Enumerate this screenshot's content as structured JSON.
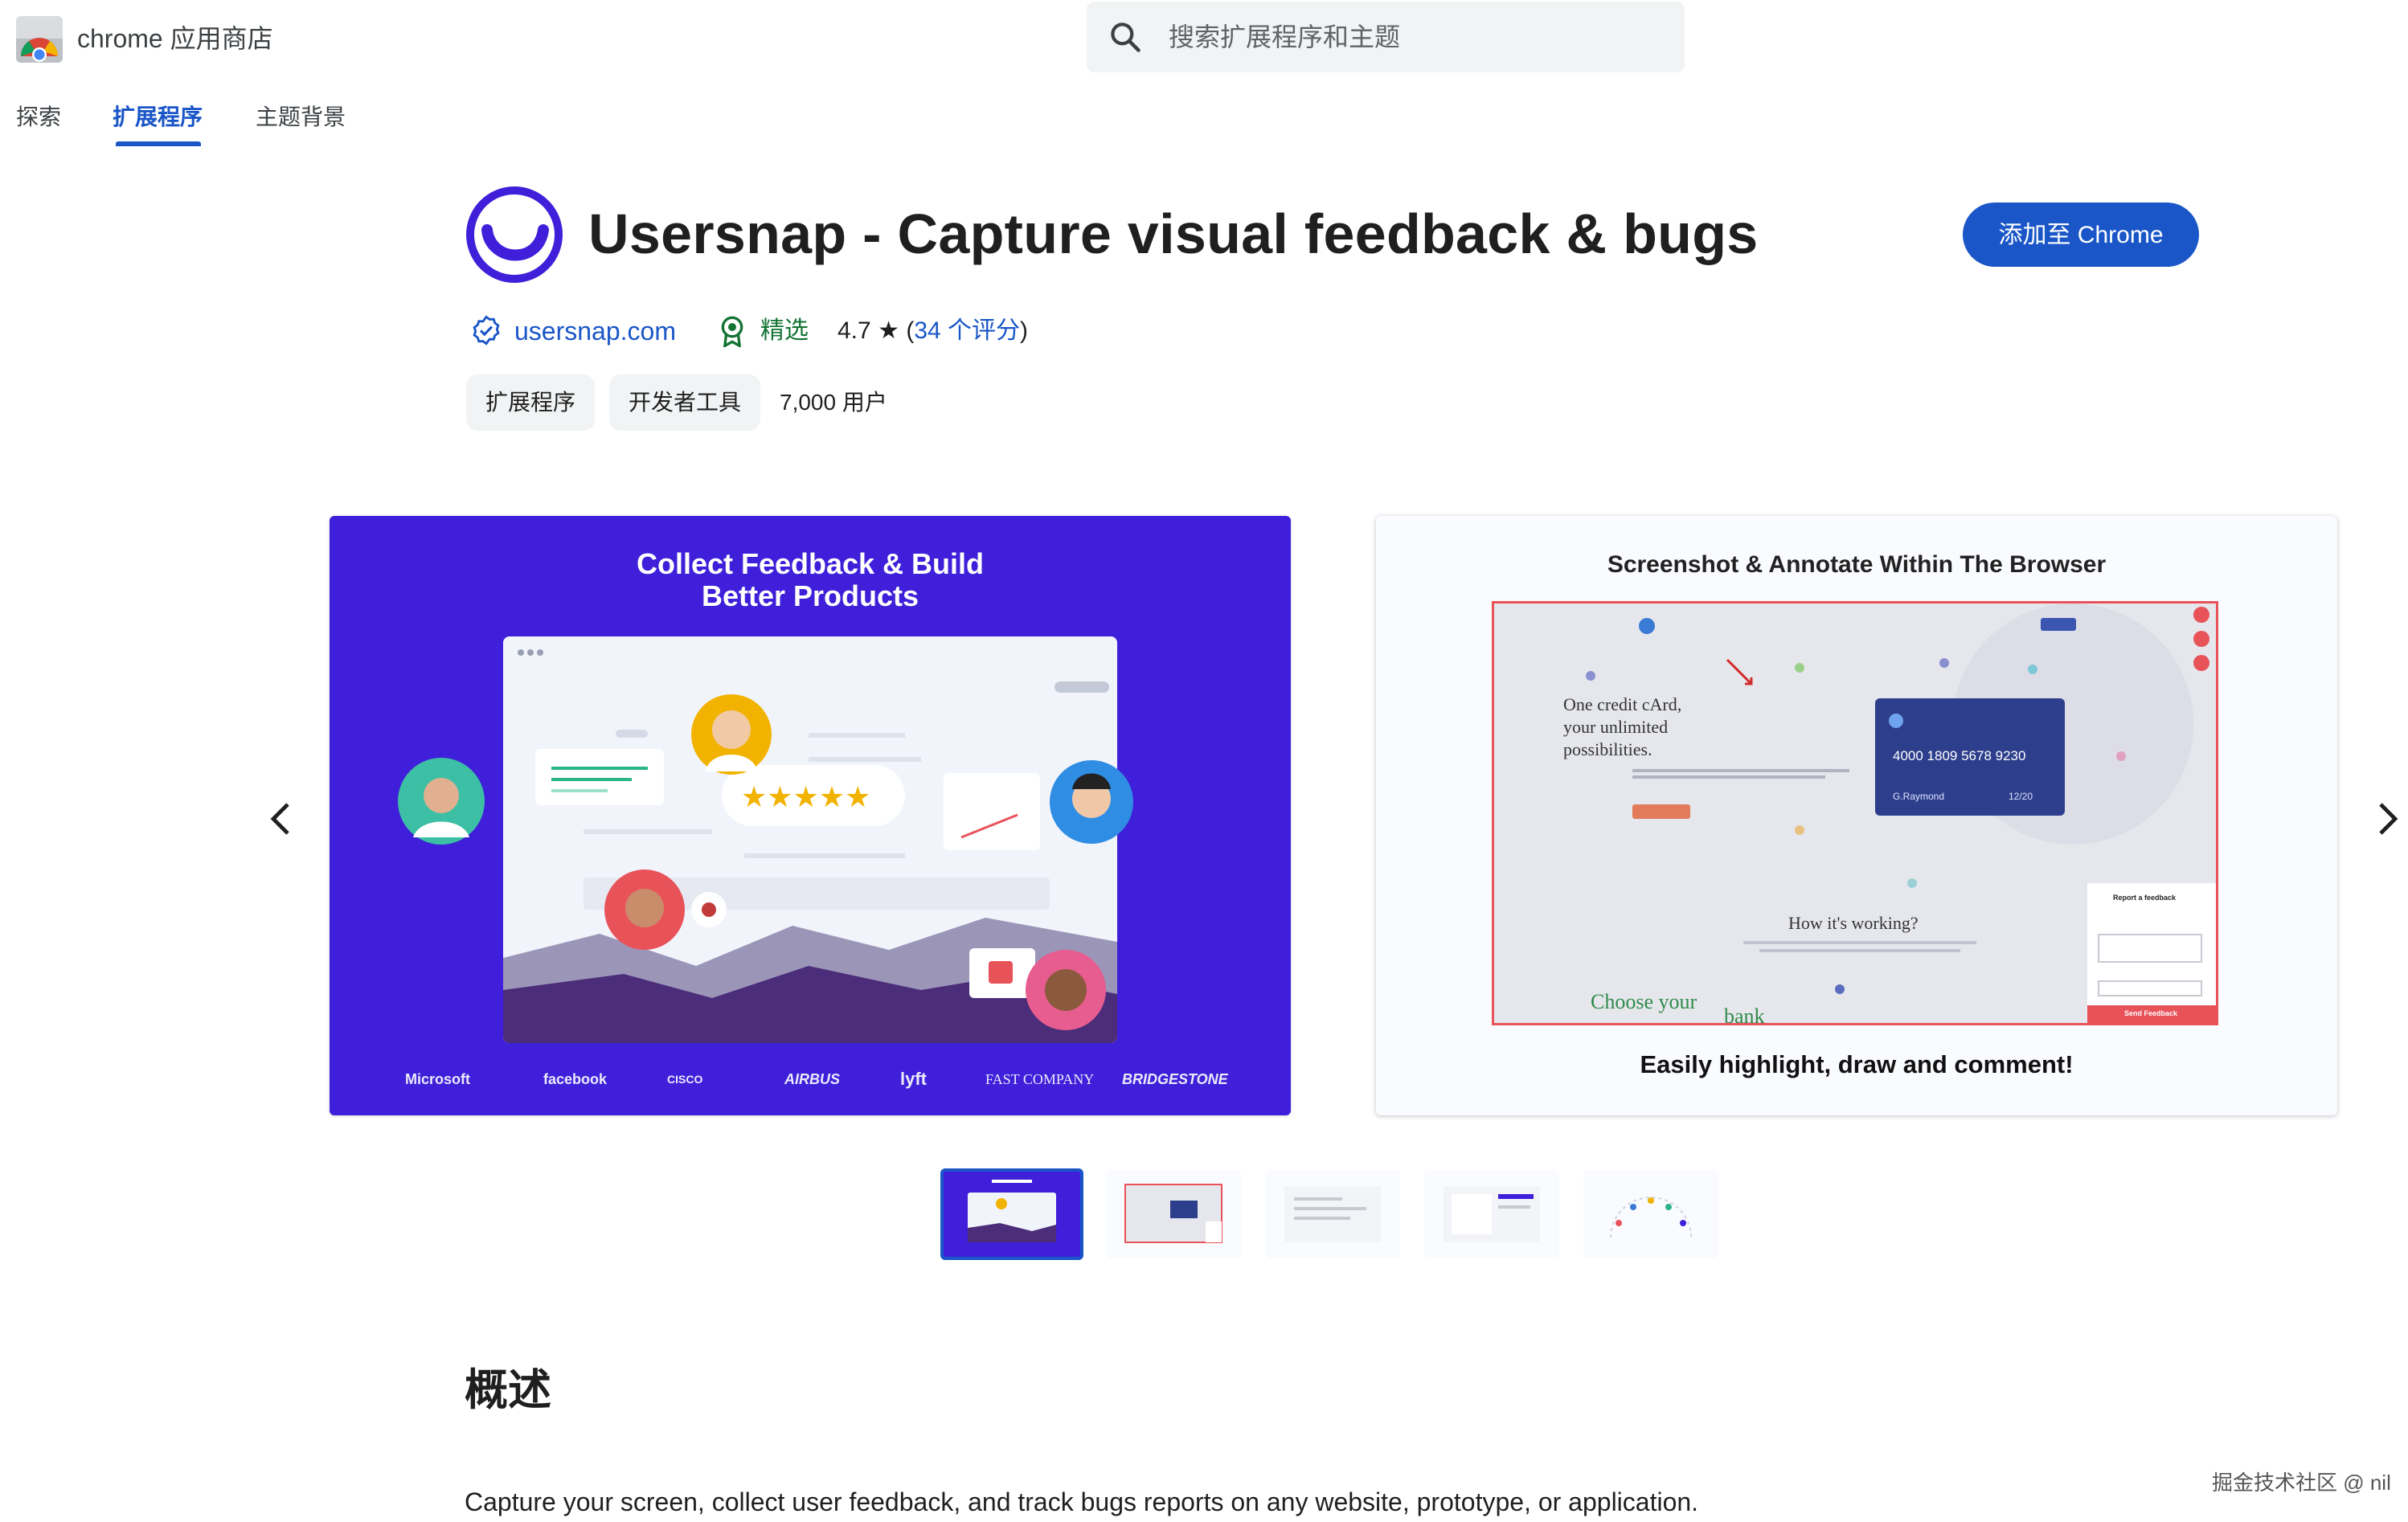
{
  "header": {
    "store_name": "chrome 应用商店",
    "search_placeholder": "搜索扩展程序和主题"
  },
  "nav": {
    "tabs": [
      {
        "label": "探索"
      },
      {
        "label": "扩展程序",
        "selected": true
      },
      {
        "label": "主题背景"
      }
    ]
  },
  "extension": {
    "title": "Usersnap - Capture visual feedback & bugs",
    "add_button": "添加至 Chrome",
    "developer": "usersnap.com",
    "featured": "精选",
    "rating": "4.7",
    "rating_star": "★",
    "rating_open": "(",
    "rating_count": "34 个评分",
    "rating_close": ")",
    "categories": [
      "扩展程序",
      "开发者工具"
    ],
    "users": "7,000 用户"
  },
  "carousel": {
    "slides": [
      {
        "title_line1": "Collect Feedback & Build",
        "title_line2": "Better Products",
        "logos": [
          "Microsoft",
          "facebook",
          "CISCO",
          "AIRBUS",
          "lyft",
          "FAST COMPANY",
          "BRIDGESTONE"
        ]
      },
      {
        "title": "Screenshot & Annotate Within The Browser",
        "caption": "Easily highlight, draw and comment!",
        "mock": {
          "headline_1": "One credit cArd,",
          "headline_2": "your unlimited",
          "headline_3": "possibilities.",
          "card_number": "4000  1809  5678  9230",
          "card_name": "G.Raymond",
          "card_expiry": "12/20",
          "section_title": "How it's working?",
          "choose": "Choose your",
          "bank": "bank",
          "panel_title": "Report a feedback",
          "panel_button": "Send Feedback"
        }
      }
    ],
    "thumbnail_count": 5
  },
  "overview": {
    "heading": "概述",
    "summary": "Capture your screen, collect user feedback, and track bugs reports on any website, prototype, or application."
  },
  "watermark": "掘金技术社区 @ nil",
  "colors": {
    "accent": "#1a56c8",
    "featured_green": "#137333",
    "slide1_bg": "#3f1fd9",
    "chip_bg": "#f1f3f4"
  },
  "icons": {
    "search": "search-icon",
    "verified": "verified-badge-icon",
    "featured": "featured-badge-icon",
    "prev": "chevron-left-icon",
    "next": "chevron-right-icon"
  }
}
